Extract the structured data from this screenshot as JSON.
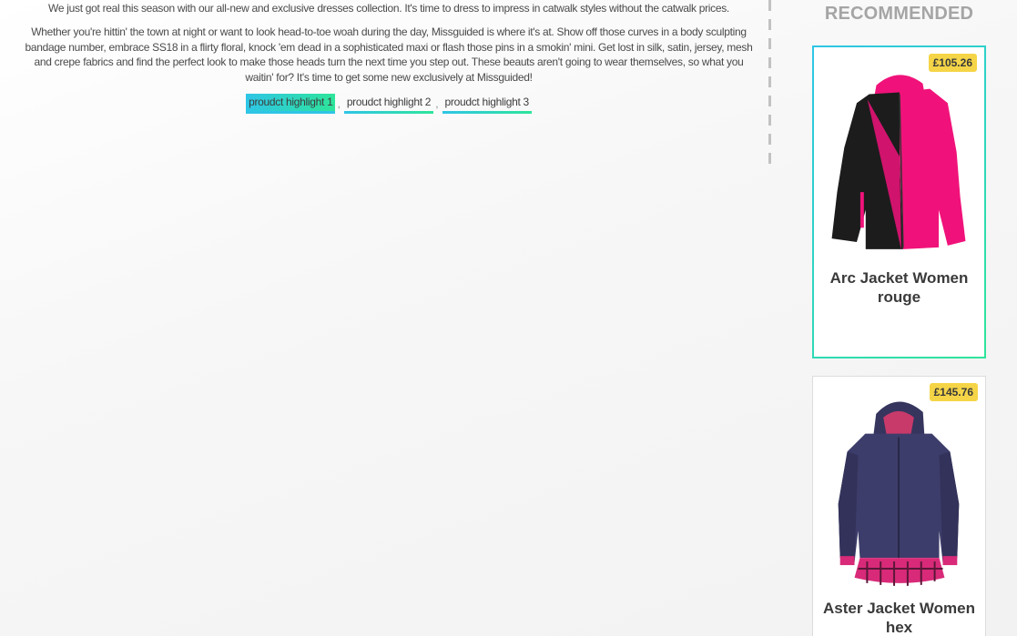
{
  "description": {
    "intro": "We just got real this season with our all-new and exclusive dresses collection. It's time to dress to impress in catwalk styles without the catwalk prices.",
    "body": "Whether you're hittin' the town at night or want to look head-to-toe woah during the day, Missguided is where it's at. Show off those curves in a body sculpting bandage number, embrace SS18 in a flirty floral, knock 'em dead in a sophisticated maxi or flash those pins in a smokin' mini. Get lost in silk, satin, jersey, mesh and crepe fabrics and find the perfect look to make those heads turn the next time you step out. These beauts aren't going to wear themselves, so what you waitin' for? It's time to get some new exclusively at Missguided!"
  },
  "highlights": {
    "items": [
      "proudct highlight 1",
      "proudct highlight 2",
      "proudct highlight 3"
    ],
    "separator": ",",
    "active_index": 0
  },
  "recommended": {
    "title": "RECOMMENDED",
    "products": [
      {
        "name": "Arc Jacket Women rouge",
        "price": "£105.26",
        "image": "pink-black-ski-jacket"
      },
      {
        "name": "Aster Jacket Women hex",
        "price": "£145.76",
        "image": "navy-hooded-jacket-plaid-trim"
      }
    ]
  },
  "colors": {
    "accent_start": "#2ec5e6",
    "accent_end": "#2ee59a",
    "price_badge": "#f5d547",
    "jacket_pink": "#f0127a",
    "jacket_navy": "#3d3d6b"
  }
}
